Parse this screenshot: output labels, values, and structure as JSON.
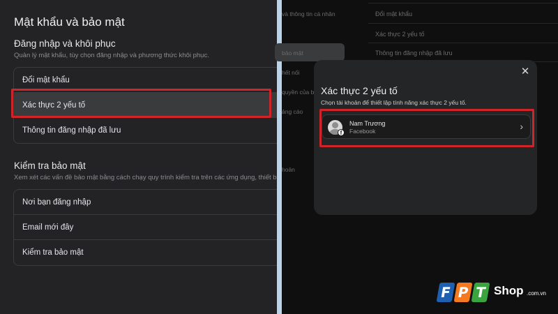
{
  "left_panel": {
    "title": "Mật khẩu và bảo mật",
    "login_section": {
      "title": "Đăng nhập và khôi phục",
      "description": "Quản lý mật khẩu, tùy chọn đăng nhập và phương thức khôi phục.",
      "items": [
        {
          "label": "Đổi mật khẩu"
        },
        {
          "label": "Xác thực 2 yếu tố",
          "highlighted": true
        },
        {
          "label": "Thông tin đăng nhập đã lưu"
        }
      ]
    },
    "security_section": {
      "title": "Kiểm tra bảo mật",
      "description": "Xem xét các vấn đề bảo mật bằng cách chạy quy trình kiểm tra trên các ứng dụng, thiết bị v",
      "items": [
        {
          "label": "Nơi bạn đăng nhập"
        },
        {
          "label": "Email mới đây"
        },
        {
          "label": "Kiểm tra bảo mật"
        }
      ]
    }
  },
  "background_nav": {
    "items": [
      {
        "label": "và thông tin cá nhân"
      },
      {
        "label": "bảo mật"
      },
      {
        "label": "hết nối"
      },
      {
        "label": "quyền của bạ"
      },
      {
        "label": "ảng cáo"
      },
      {
        "label": "hoản"
      }
    ],
    "list_items": [
      {
        "label": "Đổi mật khẩu"
      },
      {
        "label": "Xác thực 2 yếu tố"
      },
      {
        "label": "Thông tin đăng nhập đã lưu"
      }
    ]
  },
  "modal": {
    "close_icon": "close-icon",
    "title": "Xác thực 2 yếu tố",
    "description": "Chọn tài khoản để thiết lập tính năng xác thực 2 yếu tố.",
    "account": {
      "name": "Nam Trương",
      "platform": "Facebook",
      "badge_glyph": "f"
    }
  },
  "logo": {
    "letters": [
      "F",
      "P",
      "T"
    ],
    "shop": "Shop",
    "domain": ".com.vn"
  },
  "colors": {
    "highlight": "#d0242b",
    "divider": "#b9d4ea",
    "fpt_blue": "#1f5fb0",
    "fpt_orange": "#f47920",
    "fpt_green": "#3aa53f"
  }
}
